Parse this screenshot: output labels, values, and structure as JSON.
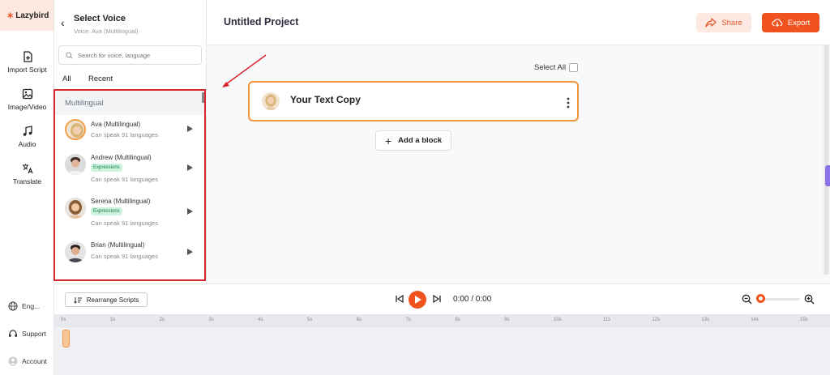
{
  "brand": {
    "name": "Lazybird",
    "color": "#f05a28"
  },
  "leftnav": {
    "items": [
      {
        "label": "Import Script",
        "icon": "file-plus-icon"
      },
      {
        "label": "Image/Video",
        "icon": "image-icon"
      },
      {
        "label": "Audio",
        "icon": "music-note-icon"
      },
      {
        "label": "Translate",
        "icon": "translate-icon"
      }
    ],
    "bottom": [
      {
        "label": "Eng...",
        "icon": "globe-icon"
      },
      {
        "label": "Support",
        "icon": "headset-icon"
      },
      {
        "label": "Account",
        "icon": "user-icon"
      }
    ]
  },
  "voice_panel": {
    "title": "Select Voice",
    "subtitle": "Voice: Ava (Multilingual)",
    "search_placeholder": "Search for voice, language",
    "tabs": [
      "All",
      "Recent"
    ],
    "section": "Multilingual",
    "voices": [
      {
        "name": "Ava (Multilingual)",
        "badge": "",
        "desc": "Can speak 91 languages",
        "selected": true
      },
      {
        "name": "Andrew (Multilingual)",
        "badge": "Expressions",
        "desc": "Can speak 91 languages",
        "selected": false
      },
      {
        "name": "Serena (Multilingual)",
        "badge": "Expressions",
        "desc": "Can speak 91 languages",
        "selected": false
      },
      {
        "name": "Brian (Multilingual)",
        "badge": "",
        "desc": "Can speak 91 languages",
        "selected": false
      }
    ]
  },
  "topbar": {
    "project_title": "Untitled Project",
    "share_label": "Share",
    "export_label": "Export",
    "accent": "#f0531f"
  },
  "editor": {
    "select_all": "Select All",
    "block_text": "Your Text Copy",
    "add_block": "Add a block"
  },
  "controls": {
    "rearrange": "Rearrange Scripts",
    "timecode": "0:00 / 0:00"
  },
  "timeline": {
    "ticks": [
      "0s",
      "1s",
      "2s",
      "3s",
      "4s",
      "5s",
      "6s",
      "7s",
      "8s",
      "9s",
      "10s",
      "11s",
      "12s",
      "13s",
      "14s",
      "15s"
    ]
  }
}
